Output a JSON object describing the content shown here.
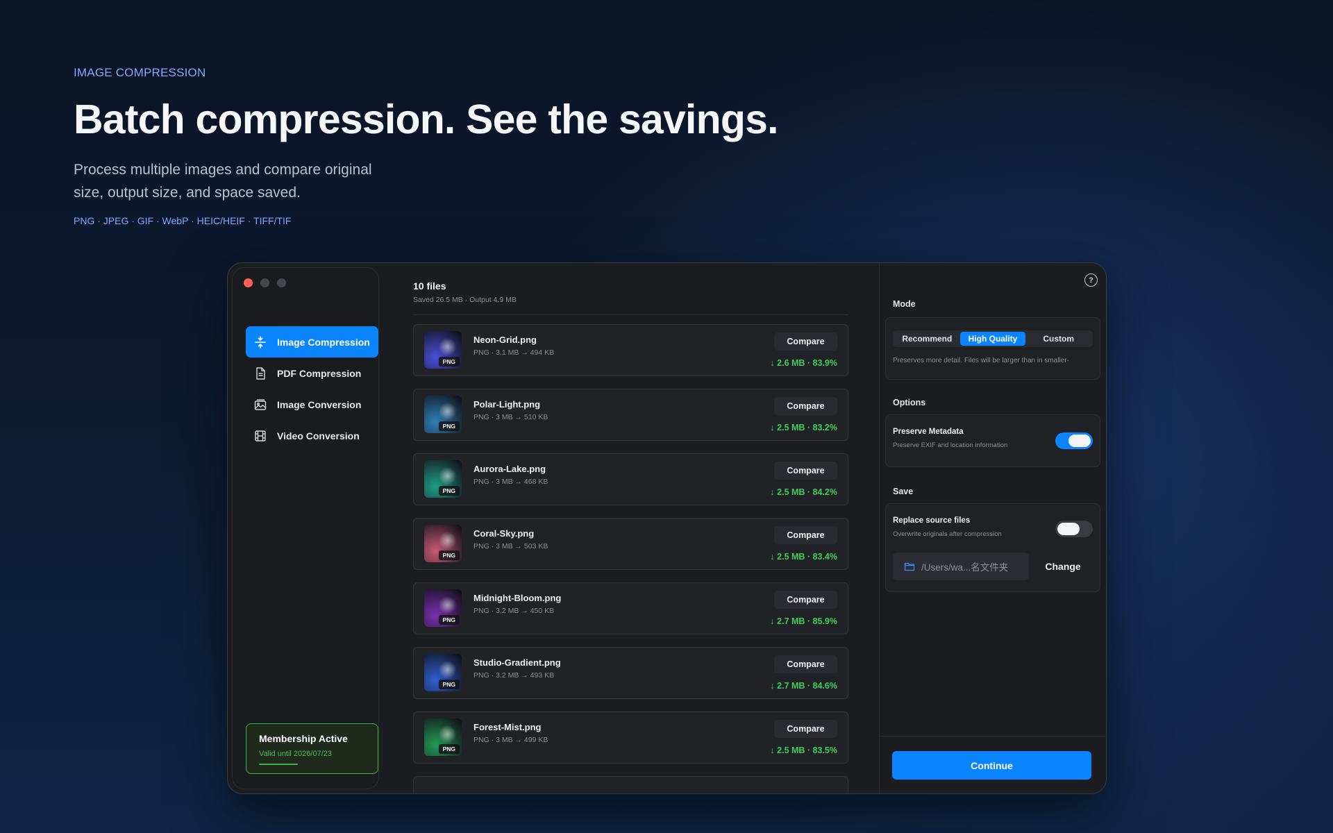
{
  "hero": {
    "eyebrow": "IMAGE COMPRESSION",
    "headline": "Batch compression. See the savings.",
    "subtext": "Process multiple images and compare original size, output size, and space saved.",
    "formats": "PNG · JPEG · GIF · WebP · HEIC/HEIF · TIFF/TIF"
  },
  "sidebar": {
    "items": [
      {
        "label": "Image Compression",
        "icon": "compress-icon",
        "active": true
      },
      {
        "label": "PDF Compression",
        "icon": "document-icon",
        "active": false
      },
      {
        "label": "Image Conversion",
        "icon": "image-icon",
        "active": false
      },
      {
        "label": "Video Conversion",
        "icon": "film-icon",
        "active": false
      }
    ],
    "membership": {
      "title": "Membership Active",
      "valid": "Valid until 2026/07/23"
    }
  },
  "files": {
    "count": "10 files",
    "summary": "Saved 26.5 MB · Output 4.9 MB",
    "compare_label": "Compare",
    "items": [
      {
        "name": "Neon-Grid.png",
        "meta": "PNG · 3.1 MB → 494 KB",
        "saved": "↓ 2.6 MB · 83.9%",
        "badge": "PNG",
        "color": "#4a4fd6"
      },
      {
        "name": "Polar-Light.png",
        "meta": "PNG · 3 MB → 510 KB",
        "saved": "↓ 2.5 MB · 83.2%",
        "badge": "PNG",
        "color": "#2e7fb8"
      },
      {
        "name": "Aurora-Lake.png",
        "meta": "PNG · 3 MB → 468 KB",
        "saved": "↓ 2.5 MB · 84.2%",
        "badge": "PNG",
        "color": "#1f9e86"
      },
      {
        "name": "Coral-Sky.png",
        "meta": "PNG · 3 MB → 503 KB",
        "saved": "↓ 2.5 MB · 83.4%",
        "badge": "PNG",
        "color": "#c95a78"
      },
      {
        "name": "Midnight-Bloom.png",
        "meta": "PNG · 3.2 MB → 450 KB",
        "saved": "↓ 2.7 MB · 85.9%",
        "badge": "PNG",
        "color": "#7a2fb0"
      },
      {
        "name": "Studio-Gradient.png",
        "meta": "PNG · 3.2 MB → 493 KB",
        "saved": "↓ 2.7 MB · 84.6%",
        "badge": "PNG",
        "color": "#2f5fd0"
      },
      {
        "name": "Forest-Mist.png",
        "meta": "PNG · 3 MB → 499 KB",
        "saved": "↓ 2.5 MB · 83.5%",
        "badge": "PNG",
        "color": "#239a55"
      }
    ]
  },
  "panel": {
    "mode_title": "Mode",
    "modes": [
      "Recommend",
      "High Quality",
      "Custom"
    ],
    "mode_active": "High Quality",
    "mode_desc": "Preserves more detail. Files will be larger than in smaller-",
    "options_title": "Options",
    "preserve_metadata": {
      "title": "Preserve Metadata",
      "sub": "Preserve EXIF and location information",
      "on": true
    },
    "save_title": "Save",
    "replace_source": {
      "title": "Replace source files",
      "sub": "Overwrite originals after compression",
      "on": false
    },
    "path": "/Users/wa...名文件夹",
    "change_label": "Change",
    "continue_label": "Continue",
    "help_label": "?"
  },
  "colors": {
    "accent": "#0a84ff",
    "success": "#3ccf5d",
    "membership": "#3bb54a"
  }
}
